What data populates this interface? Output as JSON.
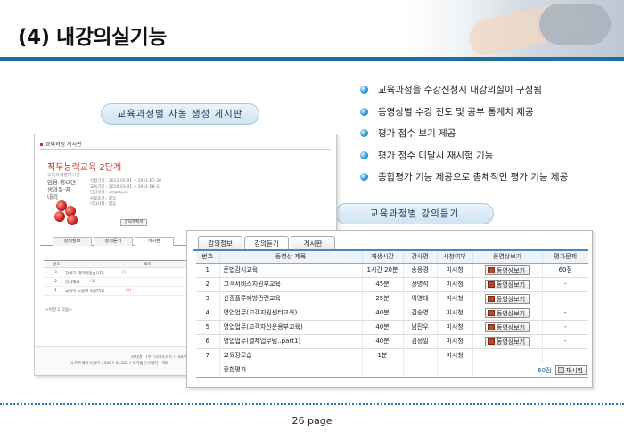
{
  "slide": {
    "title": "(4) 내강의실기능",
    "page_label": "26 page"
  },
  "captions": {
    "auto_board": "교육과정별 자동 생성 게시판",
    "lecture_list": "교육과정별 강의듣기"
  },
  "features": [
    "교육과정을 수강신청시 내강의실이 구성됨",
    "동영상별 수강 진도 및 공부 통계치 제공",
    "평가 점수 보기 제공",
    "평가 점수 미달시 재시험 기능",
    "종합평가 기능 제공으로 총체적인 평가 기능 제공"
  ],
  "board": {
    "title": "교육과정 게시판",
    "course_title": "직무능력교육 2단계",
    "course_sub": "교육과정별게시판",
    "image_text": "임용·행으뎐\n생과목·꿈\n내리",
    "info_lines": [
      "신청기간 : 2011-05-01 ~ 2011-07-30",
      "교육기간 : 2010-03-01 ~ 2011-08-31",
      "",
      "담당강사 : employee",
      "수료조건 : 없음",
      "기타사항 : 없음"
    ],
    "info_button": "강의계획서",
    "tabs": [
      "강의정보",
      "강의듣기",
      "게시판"
    ],
    "table_headers": [
      "번호",
      "제목"
    ],
    "rows": [
      {
        "num": "3",
        "title": "강의가 재미있었습니다.",
        "new": "(1)"
      },
      {
        "num": "2",
        "title": "감사해요",
        "new": "(1)"
      },
      {
        "num": "1",
        "title": "교육이 도움이 되었어요",
        "new": "(1)"
      }
    ],
    "pager": "<이전 1 다음>",
    "footer_lines": [
      "회사명 : (주) 나라소프트 / 대표이사 : 김호",
      "소프트웨어사업자 : 2007-01325 / 부가통신사업자 : 제0"
    ]
  },
  "lecture": {
    "tabs": [
      "강의정보",
      "강의듣기",
      "게시판"
    ],
    "active_tab": 1,
    "headers": [
      "번호",
      "동영상 제목",
      "재생시간",
      "강사명",
      "시청여부",
      "동영상보기",
      "평가문제"
    ],
    "play_label": "동영상보기",
    "rows": [
      {
        "no": "1",
        "title": "준법감시교육",
        "time": "1시간 20분",
        "teacher": "송응경",
        "status": "미시청",
        "score": "60점"
      },
      {
        "no": "2",
        "title": "고객서비스지원부교육",
        "time": "45분",
        "teacher": "장영석",
        "status": "미시청",
        "score": "-"
      },
      {
        "no": "3",
        "title": "신종플루예방관련교육",
        "time": "25분",
        "teacher": "이영대",
        "status": "미시청",
        "score": "-"
      },
      {
        "no": "4",
        "title": "영업업무(고객지원센터교육)",
        "time": "40분",
        "teacher": "김승영",
        "status": "미시청",
        "score": "-"
      },
      {
        "no": "5",
        "title": "영업업무(고객자산운용부교육)",
        "time": "40분",
        "teacher": "남진우",
        "status": "미시청",
        "score": "-"
      },
      {
        "no": "6",
        "title": "영업업무(결제업무팀..part1)",
        "time": "40분",
        "teacher": "김정일",
        "status": "미시청",
        "score": "-"
      },
      {
        "no": "7",
        "title": "교육장모습",
        "time": "1분",
        "teacher": "-",
        "status": "미시청",
        "score": ""
      }
    ],
    "total_label": "종합평가",
    "total_score": "60점",
    "retake_label": "재시험"
  }
}
